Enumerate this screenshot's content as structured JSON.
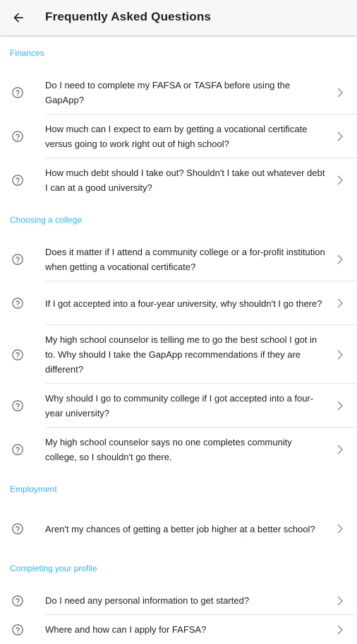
{
  "appbar": {
    "title": "Frequently Asked Questions",
    "back_icon": "arrow-back-icon"
  },
  "colors": {
    "section_header": "#29b6f6",
    "appbar_bg": "#f7f7f7",
    "divider": "#e4e4e4"
  },
  "sections": [
    {
      "title": "Finances",
      "items": [
        "Do I need to complete my FAFSA or TASFA before using the GapApp?",
        "How much can I expect to earn by getting a vocational certificate versus going to work right out of high school?",
        "How much debt should I take out? Shouldn't I take out whatever debt I can at a good university?"
      ]
    },
    {
      "title": "Choosing a college",
      "items": [
        "Does it matter if I attend a community college or a for-profit institution when getting a vocational certificate?",
        "If I got accepted into a four-year university, why shouldn't I go there?",
        "My high school counselor is telling me to go the best school I got in to. Why should I take the GapApp recommendations if they are different?",
        "Why should I go to community college if I got accepted into a four-year university?",
        "My high school counselor says no one completes community college, so I shouldn't go there."
      ]
    },
    {
      "title": "Employment",
      "items": [
        "Aren't my chances of getting a better job higher at a better school?"
      ]
    },
    {
      "title": "Completing your profile",
      "items": [
        "Do I need any personal information to get started?",
        "Where and how can I apply for FAFSA?"
      ]
    }
  ]
}
